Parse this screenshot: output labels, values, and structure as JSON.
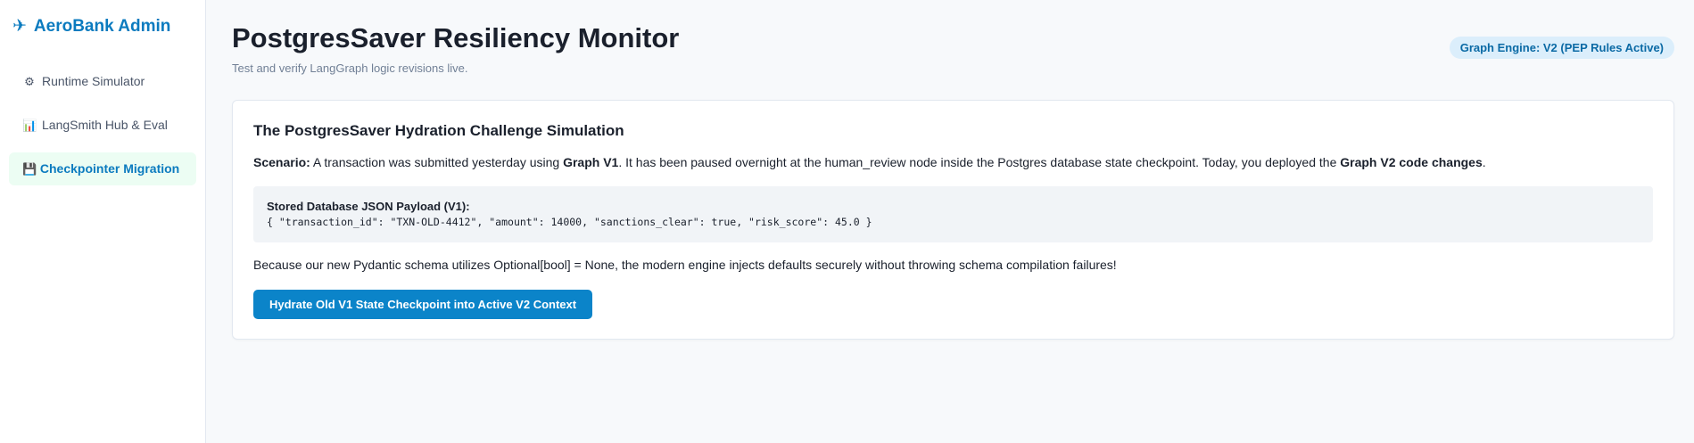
{
  "sidebar": {
    "brand": {
      "icon": "airplane-icon",
      "glyph": "✈",
      "label": "AeroBank Admin"
    },
    "items": [
      {
        "icon": "gear-icon",
        "glyph": "⚙",
        "label": "Runtime Simulator",
        "active": false
      },
      {
        "icon": "bar-chart-icon",
        "glyph": "📊",
        "label": "LangSmith Hub & Eval",
        "active": false
      },
      {
        "icon": "floppy-disk-icon",
        "glyph": "💾",
        "label": "Checkpointer Migration",
        "active": true
      }
    ]
  },
  "header": {
    "title": "PostgresSaver Resiliency Monitor",
    "subtitle": "Test and verify LangGraph logic revisions live.",
    "badge": "Graph Engine: V2 (PEP Rules Active)"
  },
  "card": {
    "title": "The PostgresSaver Hydration Challenge Simulation",
    "scenario": {
      "label": "Scenario:",
      "text1": " A transaction was submitted yesterday using ",
      "bold1": "Graph V1",
      "text2": ". It has been paused overnight at the human_review node inside the Postgres database state checkpoint. Today, you deployed the ",
      "bold2": "Graph V2 code changes",
      "text3": "."
    },
    "payload": {
      "label": "Stored Database JSON Payload (V1):",
      "code": "{ \"transaction_id\": \"TXN-OLD-4412\", \"amount\": 14000, \"sanctions_clear\": true, \"risk_score\": 45.0 }"
    },
    "note": "Because our new Pydantic schema utilizes Optional[bool] = None, the modern engine injects defaults securely without throwing schema compilation failures!",
    "button_label": "Hydrate Old V1 State Checkpoint into Active V2 Context"
  },
  "colors": {
    "accent": "#0b84c9",
    "brand": "#0b7bbf",
    "active_bg": "#ecfdf3",
    "badge_bg": "#dbeefb"
  }
}
